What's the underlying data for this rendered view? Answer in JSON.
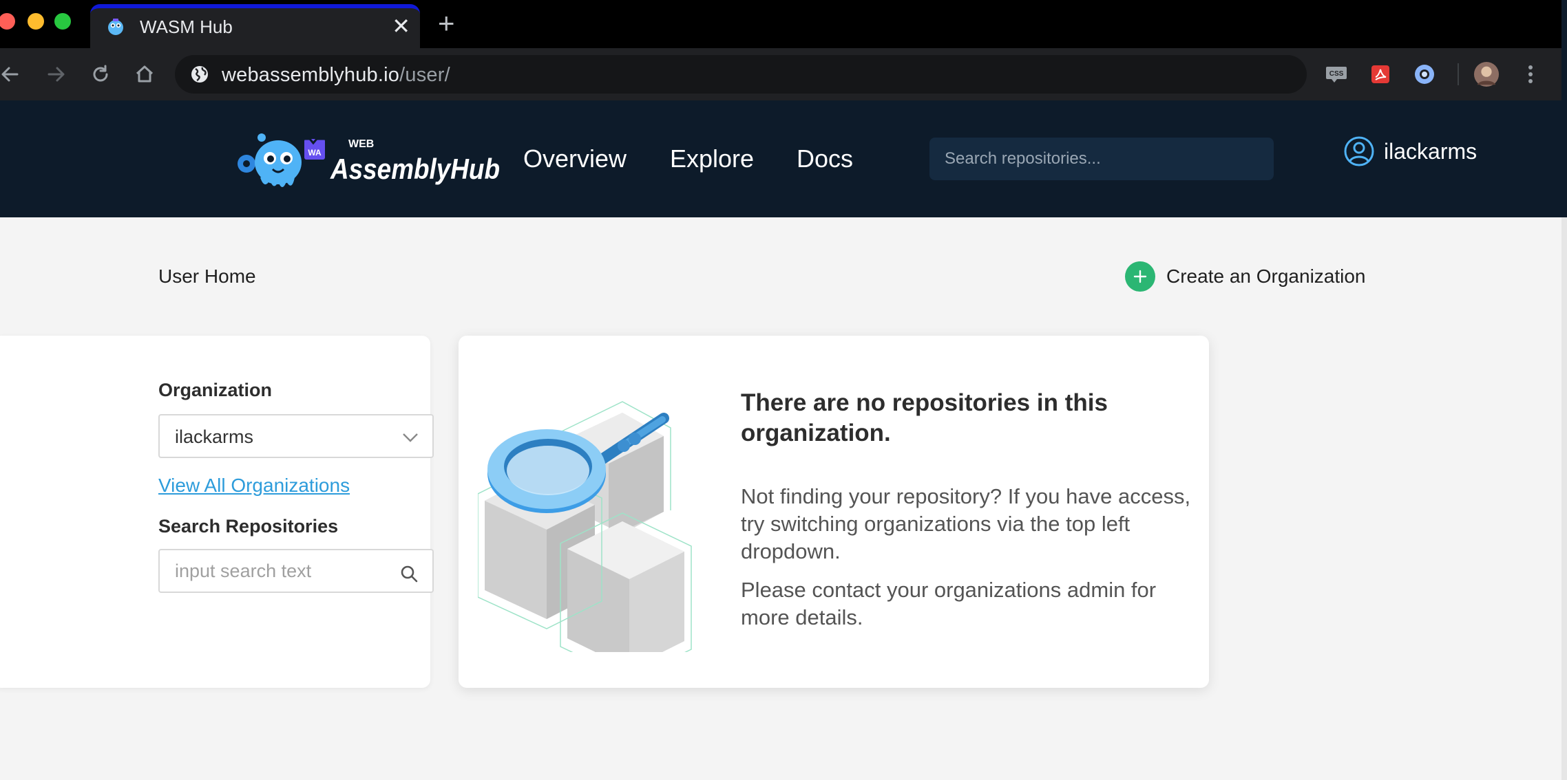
{
  "browser": {
    "tab_title": "WASM Hub",
    "tab_close": "✕",
    "new_tab": "+",
    "url_host": "webassemblyhub.io",
    "url_path": "/user/",
    "extensions": [
      "css-icon",
      "pdf-icon",
      "circle-extension-icon",
      "profile-avatar"
    ]
  },
  "header": {
    "logo_small": "WEB",
    "logo_main": "AssemblyHub",
    "logo_badge": "WA",
    "nav": [
      {
        "label": "Overview"
      },
      {
        "label": "Explore"
      },
      {
        "label": "Docs"
      }
    ],
    "search_placeholder": "Search repositories...",
    "username": "ilackarms"
  },
  "page": {
    "breadcrumb": "User Home",
    "create_org_label": "Create an Organization"
  },
  "sidebar": {
    "organization_label": "Organization",
    "organization_value": "ilackarms",
    "view_all_label": "View All Organizations",
    "search_label": "Search Repositories",
    "search_placeholder": "input search text"
  },
  "empty_state": {
    "title": "There are no repositories in this organization.",
    "message": "Not finding your repository? If you have access, try switching organizations via the top left dropdown.",
    "contact": "Please contact your organizations admin for more details."
  },
  "colors": {
    "header_bg": "#0d1b2a",
    "accent_green": "#2bb673",
    "link_blue": "#2d9cdb",
    "tab_accent": "#1019d8"
  }
}
